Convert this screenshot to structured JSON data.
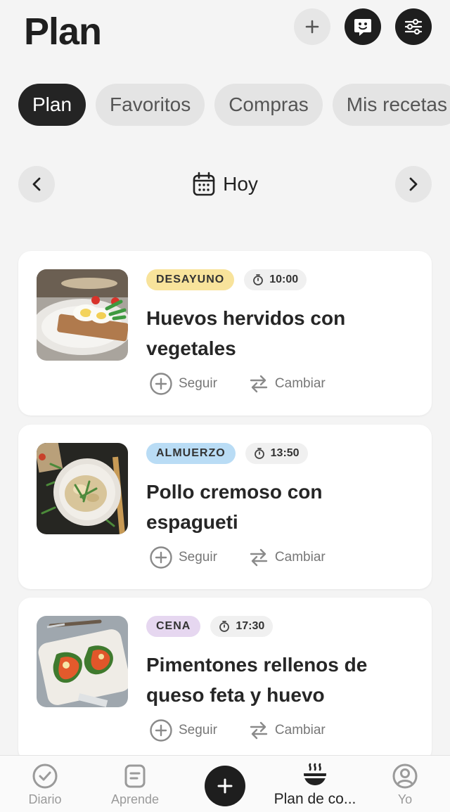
{
  "header": {
    "title": "Plan",
    "add_icon": "plus-icon",
    "chat_icon": "chat-bot-icon",
    "filter_icon": "sliders-icon"
  },
  "tabs": [
    {
      "label": "Plan",
      "active": true
    },
    {
      "label": "Favoritos",
      "active": false
    },
    {
      "label": "Compras",
      "active": false
    },
    {
      "label": "Mis recetas",
      "active": false
    }
  ],
  "date_nav": {
    "label": "Hoy",
    "icon": "calendar-icon"
  },
  "meals": [
    {
      "type": "DESAYUNO",
      "type_color": "#f8e39b",
      "time": "10:00",
      "title": "Huevos hervidos con vegetales",
      "follow_label": "Seguir",
      "change_label": "Cambiar"
    },
    {
      "type": "ALMUERZO",
      "type_color": "#b9dcf5",
      "time": "13:50",
      "title": "Pollo cremoso con espagueti",
      "follow_label": "Seguir",
      "change_label": "Cambiar"
    },
    {
      "type": "CENA",
      "type_color": "#e6d7f0",
      "time": "17:30",
      "title": "Pimentones rellenos de queso feta y huevo",
      "follow_label": "Seguir",
      "change_label": "Cambiar"
    }
  ],
  "bottom_nav": {
    "items": [
      {
        "label": "Diario",
        "icon": "check-circle-icon"
      },
      {
        "label": "Aprende",
        "icon": "note-icon"
      },
      {
        "label": "Plan de co...",
        "icon": "bowl-icon",
        "active": true
      },
      {
        "label": "Yo",
        "icon": "user-circle-icon"
      }
    ],
    "center_icon": "plus-icon"
  }
}
